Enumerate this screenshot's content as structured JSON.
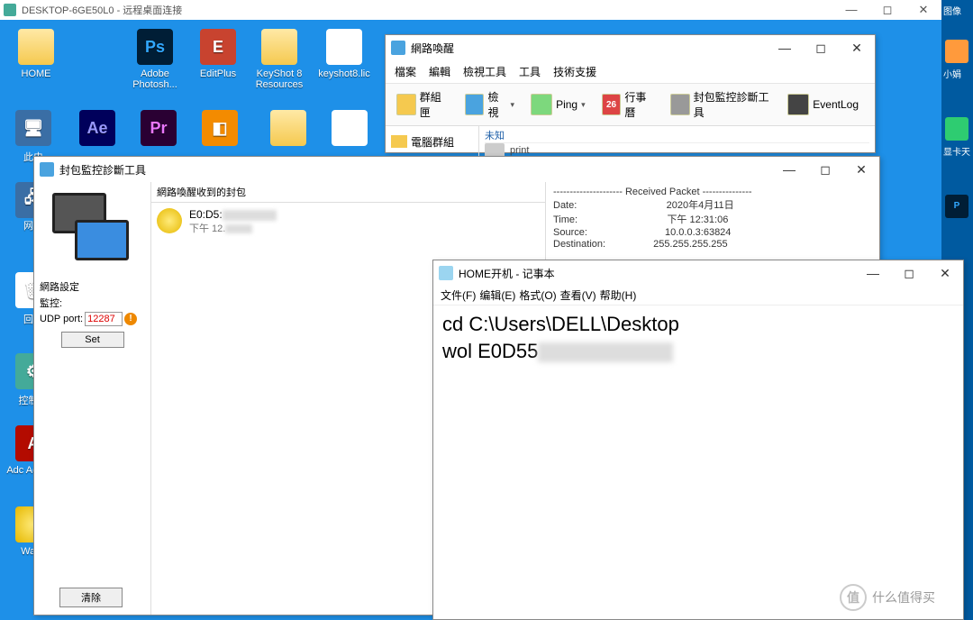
{
  "rdp": {
    "title": "DESKTOP-6GE50L0 - 远程桌面连接"
  },
  "right_col": {
    "top": "图像",
    "i1": "小娟",
    "i2": "显卡天",
    "i3": "P"
  },
  "desktop_icons": {
    "home": "HOME",
    "ps": "Adobe Photosh...",
    "ep": "EditPlus",
    "ks": "KeyShot 8 Resources",
    "lic": "keyshot8.lic",
    "ae": "Ae",
    "pr": "Pr",
    "thispc": "此电",
    "net": "网络",
    "recycle": "回收",
    "ctrl": "控制面",
    "acro": "Adc Acrobat",
    "wake": "Wake"
  },
  "wol": {
    "title": "網路喚醒",
    "menu": {
      "file": "檔案",
      "edit": "編輯",
      "view": "檢視工具",
      "tool": "工具",
      "support": "技術支援"
    },
    "toolbar": {
      "group": "群組匣",
      "view": "檢視",
      "ping": "Ping",
      "cal": "行事曆",
      "cal_day": "26",
      "pkt": "封包監控診斷工具",
      "event": "EventLog"
    },
    "tree": "電腦群組",
    "list_hdr": "未知",
    "list_item": "print"
  },
  "pkt": {
    "title": "封包監控診斷工具",
    "side": {
      "net": "網路設定",
      "mon": "監控:",
      "udp": "UDP port:",
      "port": "12287",
      "set": "Set"
    },
    "mid_hdr": "網路喚醒收到的封包",
    "entry": {
      "mac": "E0:D5:",
      "time": "下午 12."
    },
    "detail_hdr": "--------------------- Received Packet ---------------",
    "detail": {
      "date_k": "Date:",
      "date_v": "2020年4月11日",
      "time_k": "Time:",
      "time_v": "下午 12:31:06",
      "src_k": "Source:",
      "src_v": "10.0.0.3:63824",
      "dst_k": "Destination:",
      "dst_v": "255.255.255.255"
    },
    "clear": "清除"
  },
  "notepad": {
    "title": "HOME开机 - 记事本",
    "menu": {
      "file": "文件(F)",
      "edit": "编辑(E)",
      "format": "格式(O)",
      "view": "查看(V)",
      "help": "帮助(H)"
    },
    "line1": "cd C:\\Users\\DELL\\Desktop",
    "line2": "wol E0D55"
  },
  "watermark": "什么值得买"
}
